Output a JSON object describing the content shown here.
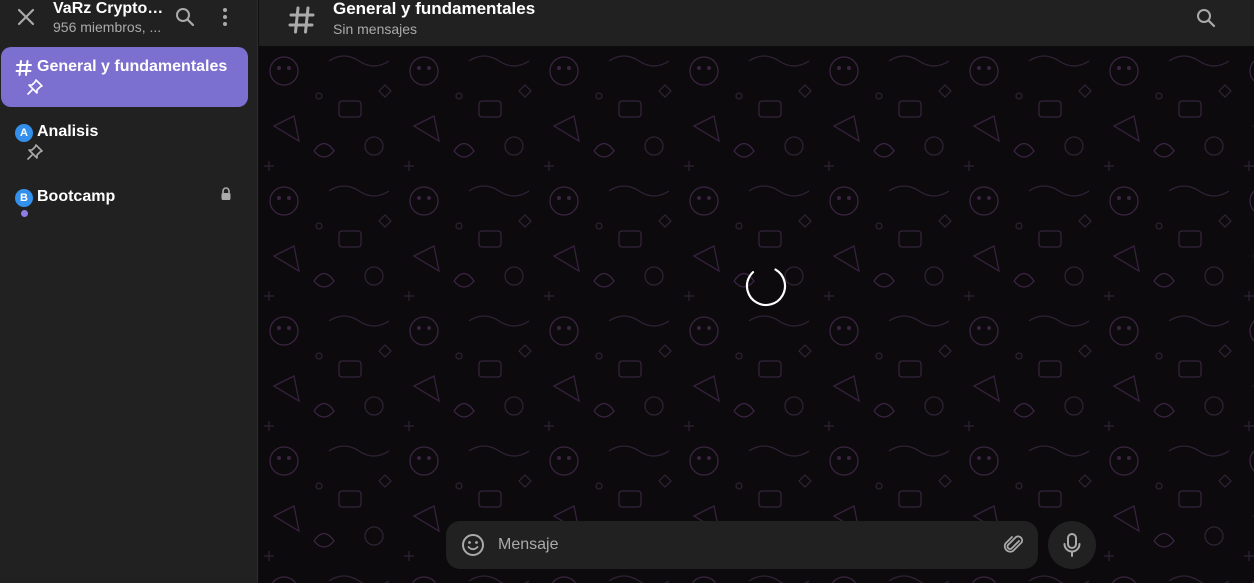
{
  "sidebar": {
    "group_title": "VaRz Crypto ...",
    "group_subtitle": "956 miembros, ...",
    "topics": [
      {
        "label": "General y fundamentales",
        "active": true,
        "pinned": true
      },
      {
        "label": "Analisis",
        "badge": "A",
        "pinned": true
      },
      {
        "label": "Bootcamp",
        "badge": "B",
        "locked": true,
        "unread_dot": true
      }
    ]
  },
  "header": {
    "title": "General y fundamentales",
    "subtitle": "Sin mensajes"
  },
  "composer": {
    "placeholder": "Mensaje"
  },
  "colors": {
    "accent": "#7b6fcf",
    "sidebar_bg": "#212121",
    "chat_bg": "#0c0a0d",
    "badge_blue": "#3390ec"
  },
  "icons": [
    "close-icon",
    "search-icon",
    "more-vertical-icon",
    "hash-icon",
    "pin-icon",
    "lock-icon",
    "emoji-icon",
    "attach-icon",
    "microphone-icon",
    "loading-spinner"
  ]
}
